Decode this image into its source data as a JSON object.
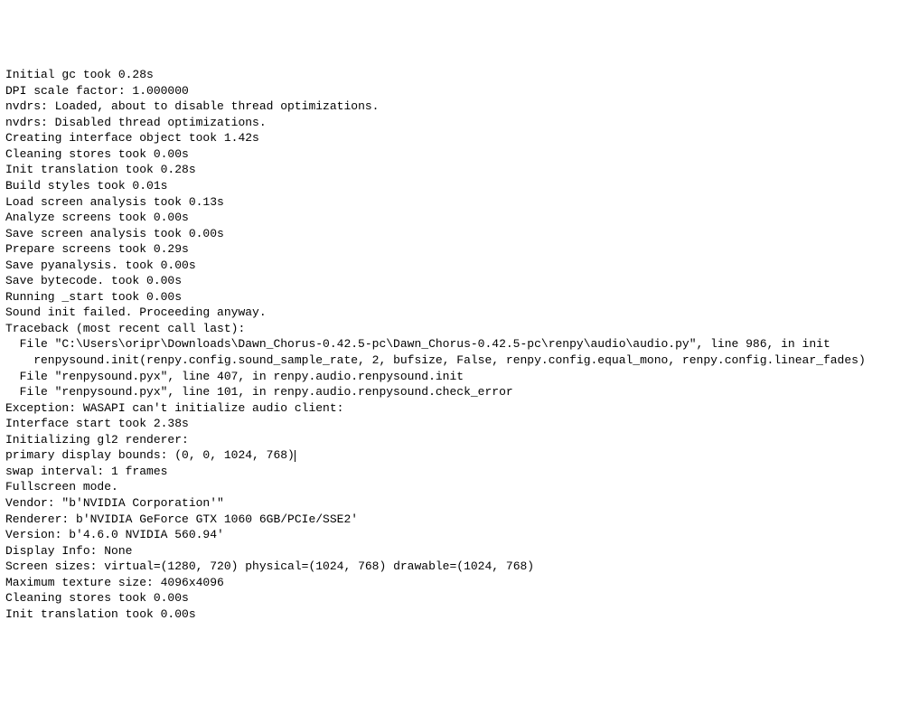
{
  "log": {
    "lines": [
      {
        "text": "Initial gc took 0.28s",
        "indent": 0
      },
      {
        "text": "DPI scale factor: 1.000000",
        "indent": 0
      },
      {
        "text": "nvdrs: Loaded, about to disable thread optimizations.",
        "indent": 0
      },
      {
        "text": "nvdrs: Disabled thread optimizations.",
        "indent": 0
      },
      {
        "text": "Creating interface object took 1.42s",
        "indent": 0
      },
      {
        "text": "Cleaning stores took 0.00s",
        "indent": 0
      },
      {
        "text": "Init translation took 0.28s",
        "indent": 0
      },
      {
        "text": "Build styles took 0.01s",
        "indent": 0
      },
      {
        "text": "Load screen analysis took 0.13s",
        "indent": 0
      },
      {
        "text": "Analyze screens took 0.00s",
        "indent": 0
      },
      {
        "text": "Save screen analysis took 0.00s",
        "indent": 0
      },
      {
        "text": "Prepare screens took 0.29s",
        "indent": 0
      },
      {
        "text": "Save pyanalysis. took 0.00s",
        "indent": 0
      },
      {
        "text": "Save bytecode. took 0.00s",
        "indent": 0
      },
      {
        "text": "Running _start took 0.00s",
        "indent": 0
      },
      {
        "text": "Sound init failed. Proceeding anyway.",
        "indent": 0
      },
      {
        "text": "Traceback (most recent call last):",
        "indent": 0
      },
      {
        "text": "File \"C:\\Users\\oripr\\Downloads\\Dawn_Chorus-0.42.5-pc\\Dawn_Chorus-0.42.5-pc\\renpy\\audio\\audio.py\", line 986, in init",
        "indent": 1
      },
      {
        "text": "renpysound.init(renpy.config.sound_sample_rate, 2, bufsize, False, renpy.config.equal_mono, renpy.config.linear_fades)",
        "indent": 2
      },
      {
        "text": "File \"renpysound.pyx\", line 407, in renpy.audio.renpysound.init",
        "indent": 1
      },
      {
        "text": "File \"renpysound.pyx\", line 101, in renpy.audio.renpysound.check_error",
        "indent": 1
      },
      {
        "text": "Exception: WASAPI can't initialize audio client:",
        "indent": 0
      },
      {
        "text": "Interface start took 2.38s",
        "indent": 0
      },
      {
        "text": "",
        "indent": 0
      },
      {
        "text": "Initializing gl2 renderer:",
        "indent": 0
      },
      {
        "text": "primary display bounds: (0, 0, 1024, 768)",
        "indent": 0,
        "cursor": true
      },
      {
        "text": "swap interval: 1 frames",
        "indent": 0
      },
      {
        "text": "Fullscreen mode.",
        "indent": 0
      },
      {
        "text": "Vendor: \"b'NVIDIA Corporation'\"",
        "indent": 0
      },
      {
        "text": "Renderer: b'NVIDIA GeForce GTX 1060 6GB/PCIe/SSE2'",
        "indent": 0
      },
      {
        "text": "Version: b'4.6.0 NVIDIA 560.94'",
        "indent": 0
      },
      {
        "text": "Display Info: None",
        "indent": 0
      },
      {
        "text": "Screen sizes: virtual=(1280, 720) physical=(1024, 768) drawable=(1024, 768)",
        "indent": 0
      },
      {
        "text": "Maximum texture size: 4096x4096",
        "indent": 0
      },
      {
        "text": "Cleaning stores took 0.00s",
        "indent": 0
      },
      {
        "text": "Init translation took 0.00s",
        "indent": 0
      }
    ]
  }
}
